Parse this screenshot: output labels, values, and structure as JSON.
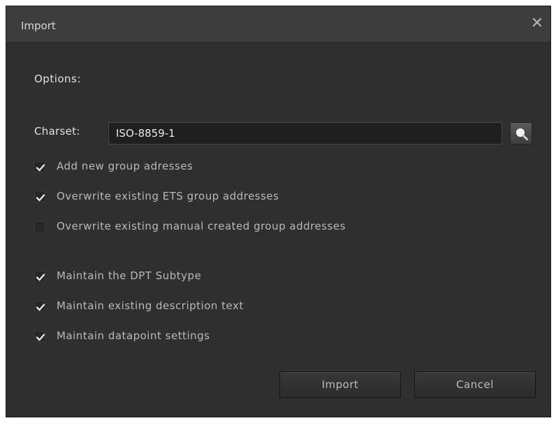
{
  "window": {
    "title": "Import",
    "close_symbol": "✕"
  },
  "options_label": "Options:",
  "charset": {
    "label": "Charset:",
    "value": "ISO-8859-1",
    "search_icon": "search-icon"
  },
  "options": [
    {
      "label": "Add new group adresses",
      "checked": true
    },
    {
      "label": "Overwrite existing ETS group addresses",
      "checked": true
    },
    {
      "label": "Overwrite existing manual created group addresses",
      "checked": false
    },
    {
      "label": "Maintain the DPT Subtype",
      "checked": true
    },
    {
      "label": "Maintain existing description text",
      "checked": true
    },
    {
      "label": "Maintain datapoint settings",
      "checked": true
    }
  ],
  "buttons": {
    "import_label": "Import",
    "cancel_label": "Cancel"
  },
  "colors": {
    "dialog_bg": "#2f2f2f",
    "titlebar_bg": "#3d3d3d",
    "text": "#b9b9b9",
    "checkmark": "#e6e6e6"
  }
}
